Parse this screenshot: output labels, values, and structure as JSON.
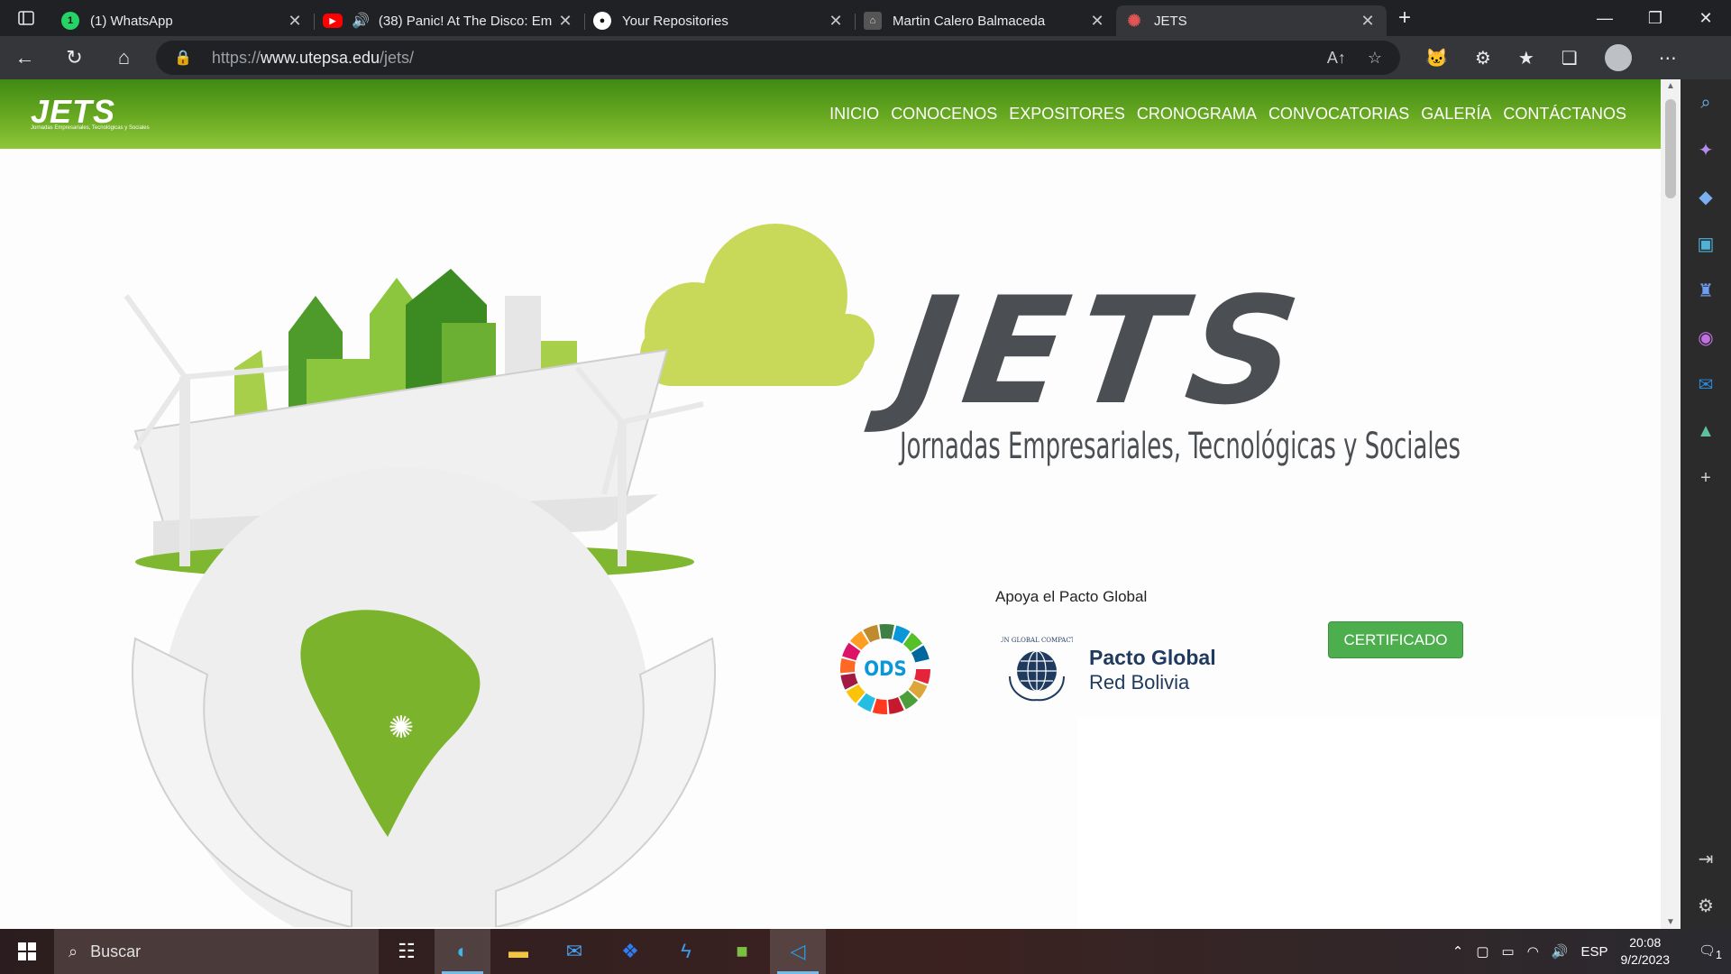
{
  "browser": {
    "tabs": [
      {
        "title": "(1) WhatsApp",
        "icon": "whatsapp-icon",
        "color": "#25d366",
        "badge": "1"
      },
      {
        "title": "(38) Panic! At The Disco: Em",
        "icon": "youtube-icon",
        "color": "#ff0000",
        "audio": true
      },
      {
        "title": "Your Repositories",
        "icon": "github-icon",
        "color": "#ffffff"
      },
      {
        "title": "Martin Calero Balmaceda",
        "icon": "profile-icon",
        "color": "#b0b0b0"
      },
      {
        "title": "JETS",
        "icon": "jets-favicon",
        "color": "#e25555",
        "active": true
      }
    ],
    "url_prefix": "https://",
    "url_host": "www.utepsa.edu",
    "url_path": "/jets/"
  },
  "site": {
    "logo_text": "JETS",
    "logo_tagline": "Jornadas Empresariales, Tecnológicas y Sociales",
    "menu": [
      "INICIO",
      "CONOCENOS",
      "EXPOSITORES",
      "CRONOGRAMA",
      "CONVOCATORIAS",
      "GALERÍA",
      "CONTÁCTANOS"
    ],
    "hero_title": "JETS",
    "hero_subtitle": "Jornadas Empresariales, Tecnológicas y Sociales",
    "support_label": "Apoya el Pacto Global",
    "cert_button": "CERTIFICADO",
    "ods_label": "ODS",
    "un_label": "UN GLOBAL COMPACT",
    "pacto_line1": "Pacto Global",
    "pacto_line2": "Red Bolivia",
    "brand_green": "#6aaa22",
    "text_gray": "#4b4e52"
  },
  "taskbar": {
    "search_placeholder": "Buscar",
    "language": "ESP",
    "time": "20:08",
    "date": "9/2/2023",
    "notifications": "1"
  }
}
